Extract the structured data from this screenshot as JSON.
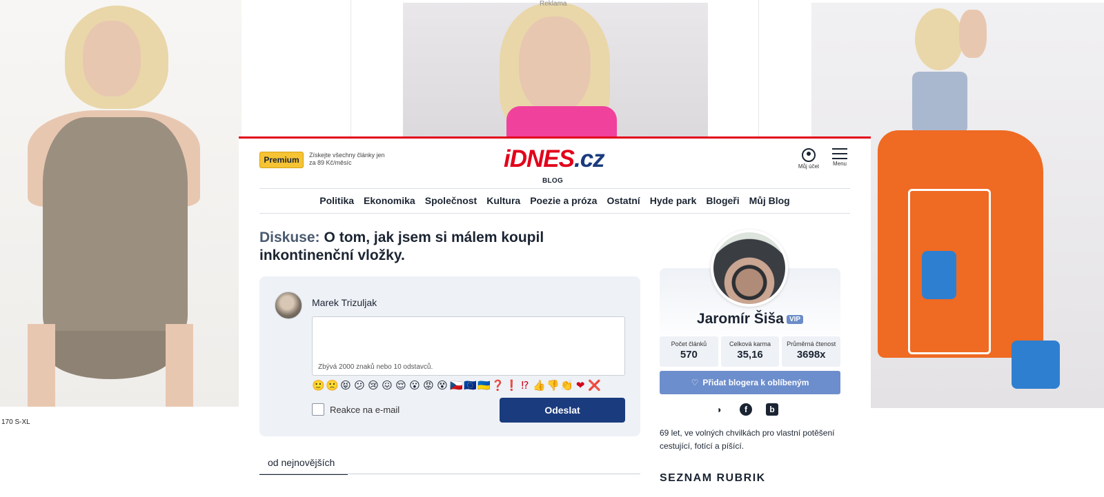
{
  "ads": {
    "label": "Reklama",
    "caption": "170 S-XL"
  },
  "header": {
    "premium_label": "Premium",
    "premium_note": "Získejte všechny články jen za 89 Kč/měsíc",
    "logo_main": "iDNES",
    "logo_tld": ".cz",
    "logo_sub": "BLOG",
    "account_label": "Můj účet",
    "menu_label": "Menu"
  },
  "nav": [
    "Politika",
    "Ekonomika",
    "Společnost",
    "Kultura",
    "Poezie a próza",
    "Ostatní",
    "Hyde park",
    "Blogeři",
    "Můj Blog"
  ],
  "discussion": {
    "lead": "Diskuse:",
    "title": "O tom, jak jsem si málem koupil inkontinenční vložky."
  },
  "comment_form": {
    "user_name": "Marek Trizuljak",
    "counter": "Zbývá 2000 znaků nebo 10 odstavců.",
    "emojis": [
      "🙂",
      "🙁",
      "😝",
      "😕",
      "😢",
      "😖",
      "😌",
      "😮",
      "😡",
      "😵",
      "🇨🇿",
      "🇪🇺",
      "🇺🇦",
      "❓",
      "❗",
      "⁉",
      "👍",
      "👎",
      "👏",
      "❤",
      "❌"
    ],
    "email_label": "Reakce na e-mail",
    "submit_label": "Odeslat"
  },
  "sort_tab": "od nejnovějších",
  "blogger": {
    "name": "Jaromír Šiša",
    "badge": "VIP",
    "stats": [
      {
        "label": "Počet článků",
        "value": "570"
      },
      {
        "label": "Celková karma",
        "value": "35,16"
      },
      {
        "label": "Průměrná čtenost",
        "value": "3698x"
      }
    ],
    "favorite_label": "Přidat blogera k oblíbeným",
    "bio": "69 let, ve volných chvilkách pro vlastní potěšení cestující, fotící a píšící.",
    "section_heading": "SEZNAM RUBRIK"
  },
  "colors": {
    "brand_red": "#e2001a",
    "brand_blue": "#1a3b7e",
    "premium_yellow": "#f5c334",
    "favorite_blue": "#6d8ecc"
  }
}
